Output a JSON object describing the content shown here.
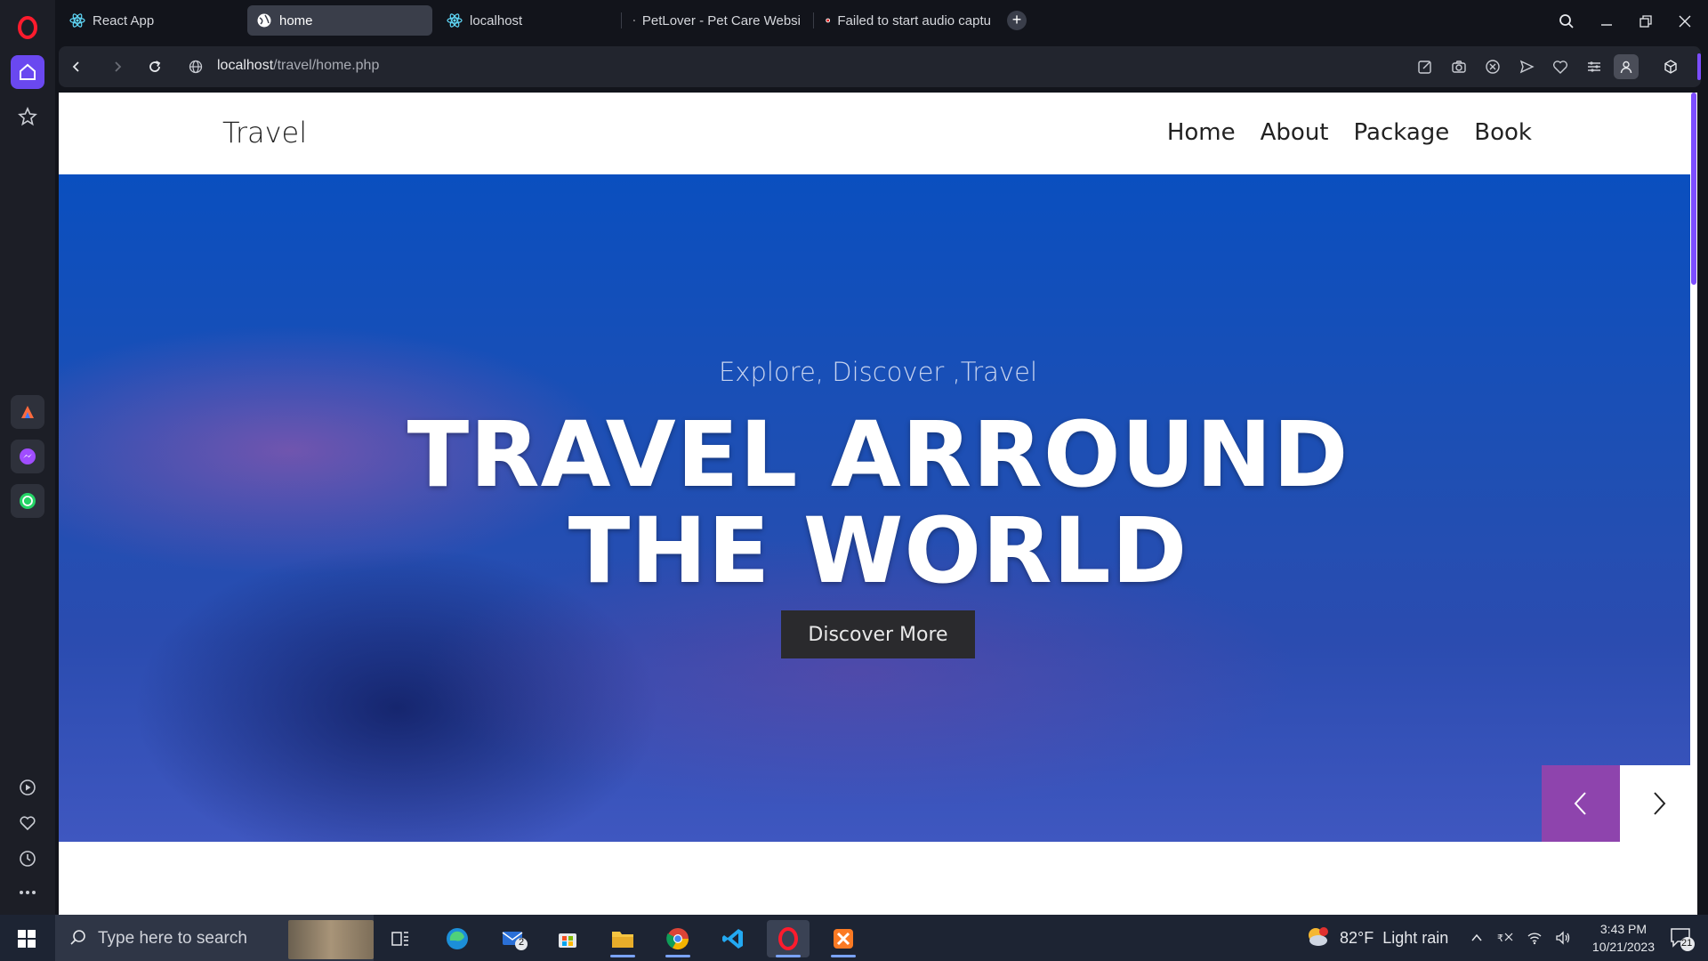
{
  "browser": {
    "tabs": [
      {
        "label": "React App",
        "icon": "react-icon"
      },
      {
        "label": "home",
        "icon": "globe-icon",
        "active": true
      },
      {
        "label": "localhost",
        "icon": "react-icon"
      },
      {
        "label": "PetLover - Pet Care Websi",
        "icon": "globe-icon"
      },
      {
        "label": "Failed to start audio captu",
        "icon": "record-icon"
      }
    ],
    "url_host": "localhost",
    "url_path": "/travel/home.php"
  },
  "site": {
    "brand": "Travel",
    "nav": [
      "Home",
      "About",
      "Package",
      "Book"
    ],
    "hero": {
      "subtitle": "Explore, Discover ,Travel",
      "title_line1": "TRAVEL ARROUND",
      "title_line2": "THE WORLD",
      "cta": "Discover More"
    }
  },
  "taskbar": {
    "search_placeholder": "Type here to search",
    "mail_badge": "2",
    "weather_temp": "82°F",
    "weather_desc": "Light rain",
    "time": "3:43 PM",
    "date": "10/21/2023",
    "notification_count": "21"
  },
  "colors": {
    "opera_accent": "#6a48f0",
    "hero_blue": "#1f4fb3",
    "slider_prev": "#8e44ad",
    "cta_bg": "#2a2a2d"
  }
}
